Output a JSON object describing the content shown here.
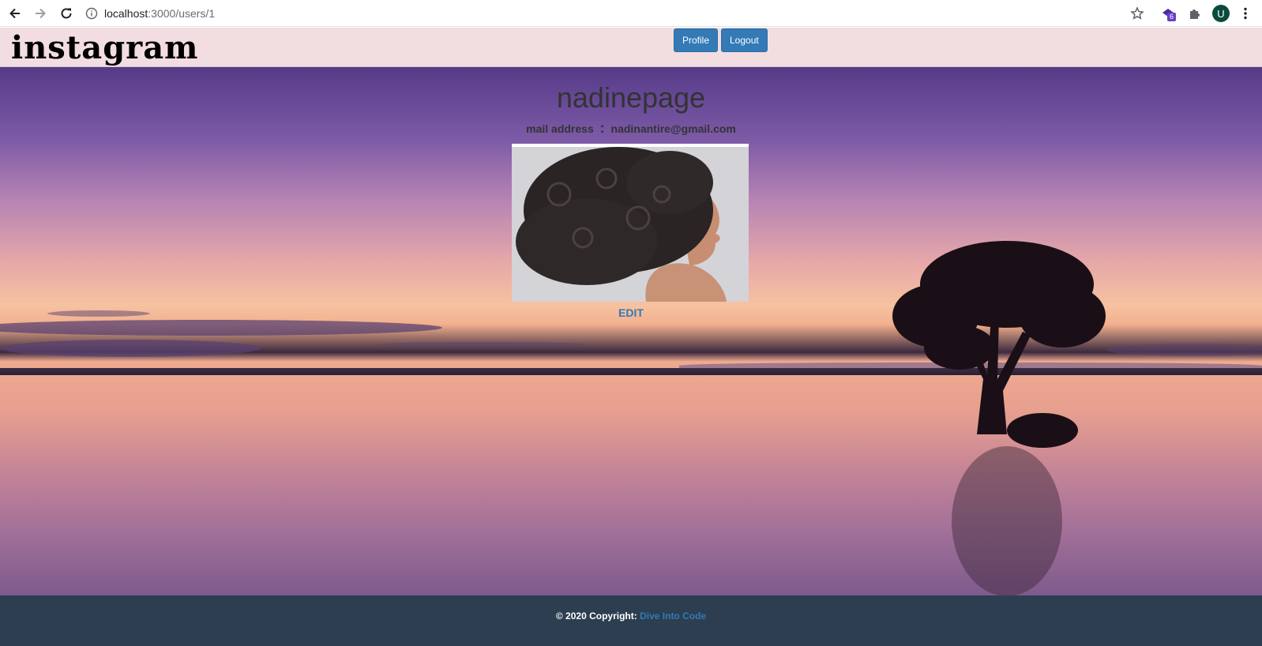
{
  "browser": {
    "url_host": "localhost",
    "url_path": ":3000/users/1",
    "extension_badge": "6",
    "profile_initial": "U"
  },
  "header": {
    "logo": "instagram",
    "profile_label": "Profile",
    "logout_label": "Logout"
  },
  "user": {
    "username": "nadinepage",
    "mail_label": "mail address",
    "mail_colon": ":",
    "email": "nadinantire@gmail.com",
    "edit_label": "EDIT"
  },
  "footer": {
    "copyright": "© 2020 Copyright:",
    "link_text": "Dive Into Code"
  },
  "colors": {
    "topbar": "#f2dde0",
    "button": "#337ab7",
    "footer": "#2c3e50",
    "link": "#337ab7"
  }
}
